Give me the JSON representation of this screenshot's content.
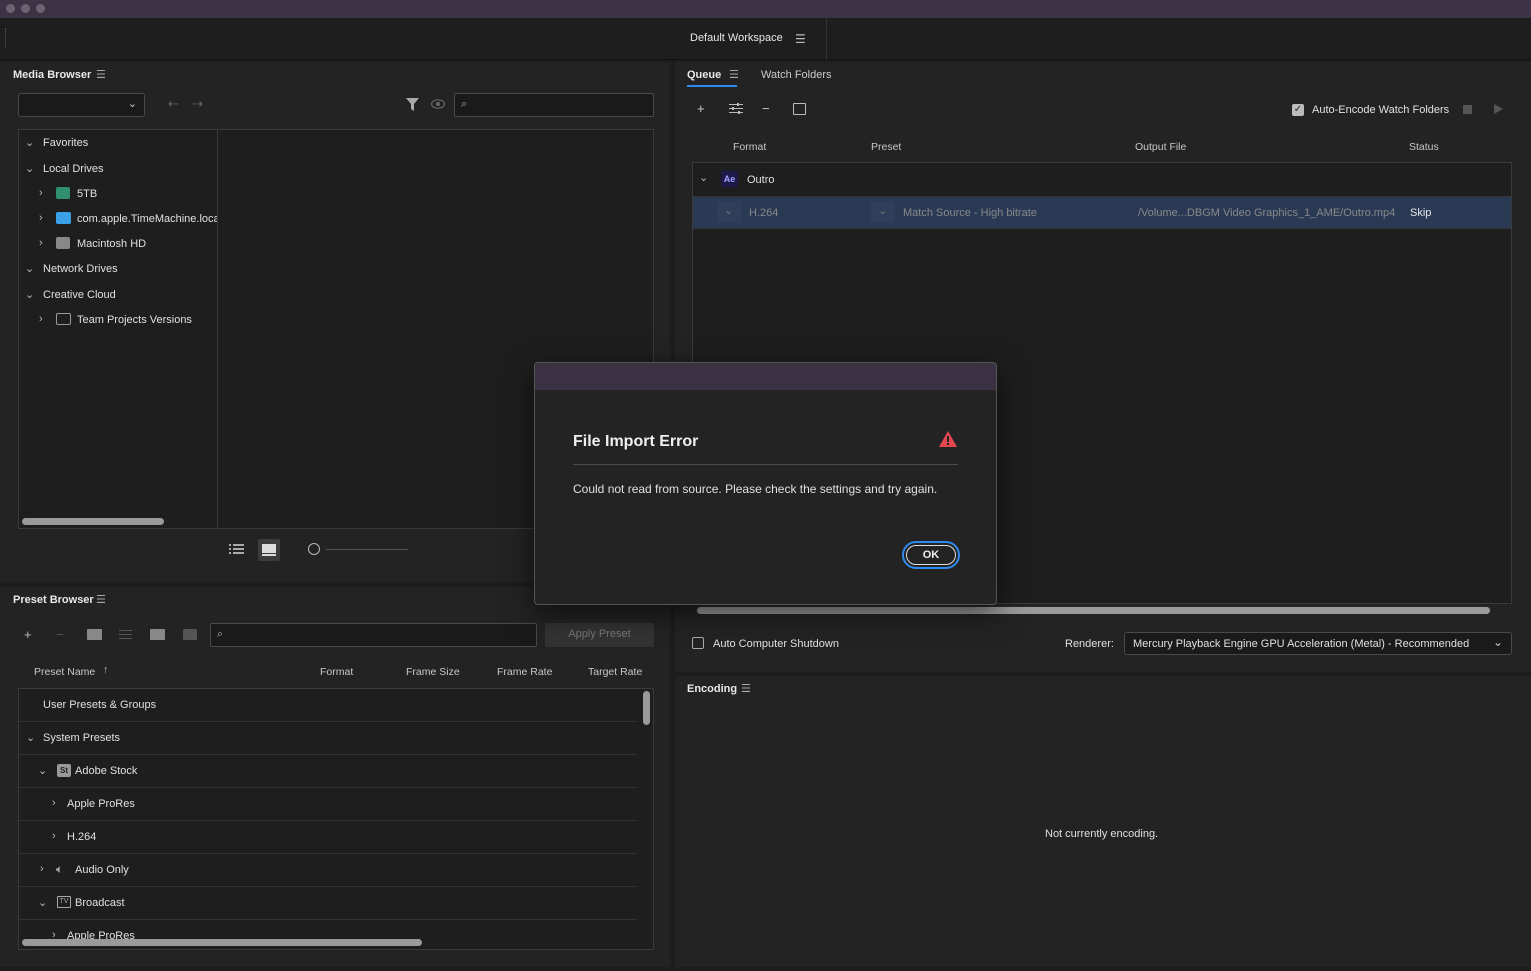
{
  "workspace": {
    "title": "Default Workspace"
  },
  "media_browser": {
    "title": "Media Browser",
    "tree": [
      {
        "label": "Favorites"
      },
      {
        "label": "Local Drives"
      },
      {
        "label": "5TB"
      },
      {
        "label": "com.apple.TimeMachine.loca"
      },
      {
        "label": "Macintosh HD"
      },
      {
        "label": "Network Drives"
      },
      {
        "label": "Creative Cloud"
      },
      {
        "label": "Team Projects Versions"
      }
    ]
  },
  "queue": {
    "tab_queue": "Queue",
    "tab_watch": "Watch Folders",
    "auto_encode": "Auto-Encode Watch Folders",
    "columns": {
      "format": "Format",
      "preset": "Preset",
      "output": "Output File",
      "status": "Status"
    },
    "group": {
      "badge": "Ae",
      "name": "Outro"
    },
    "item": {
      "format": "H.264",
      "preset": "Match Source - High bitrate",
      "output": "/Volume...DBGM Video Graphics_1_AME/Outro.mp4",
      "status": "Skip"
    },
    "auto_shutdown": "Auto Computer Shutdown",
    "renderer_label": "Renderer:",
    "renderer_value": "Mercury Playback Engine GPU Acceleration (Metal) - Recommended"
  },
  "preset_browser": {
    "title": "Preset Browser",
    "apply": "Apply Preset",
    "columns": {
      "name": "Preset Name",
      "format": "Format",
      "frame_size": "Frame Size",
      "frame_rate": "Frame Rate",
      "target_rate": "Target Rate"
    },
    "rows": [
      {
        "label": "User Presets & Groups"
      },
      {
        "label": "System Presets"
      },
      {
        "label": "Adobe Stock"
      },
      {
        "label": "Apple ProRes"
      },
      {
        "label": "H.264"
      },
      {
        "label": "Audio Only"
      },
      {
        "label": "Broadcast"
      },
      {
        "label": "Apple ProRes"
      }
    ]
  },
  "encoding": {
    "title": "Encoding",
    "status": "Not currently encoding."
  },
  "dialog": {
    "title": "File Import Error",
    "message": "Could not read from source. Please check the settings and try again.",
    "ok": "OK"
  },
  "colors": {
    "accent": "#2d8ceb",
    "selected_row": "#2a3a55",
    "warning": "#e34850",
    "title_bar": "#3c3344"
  }
}
